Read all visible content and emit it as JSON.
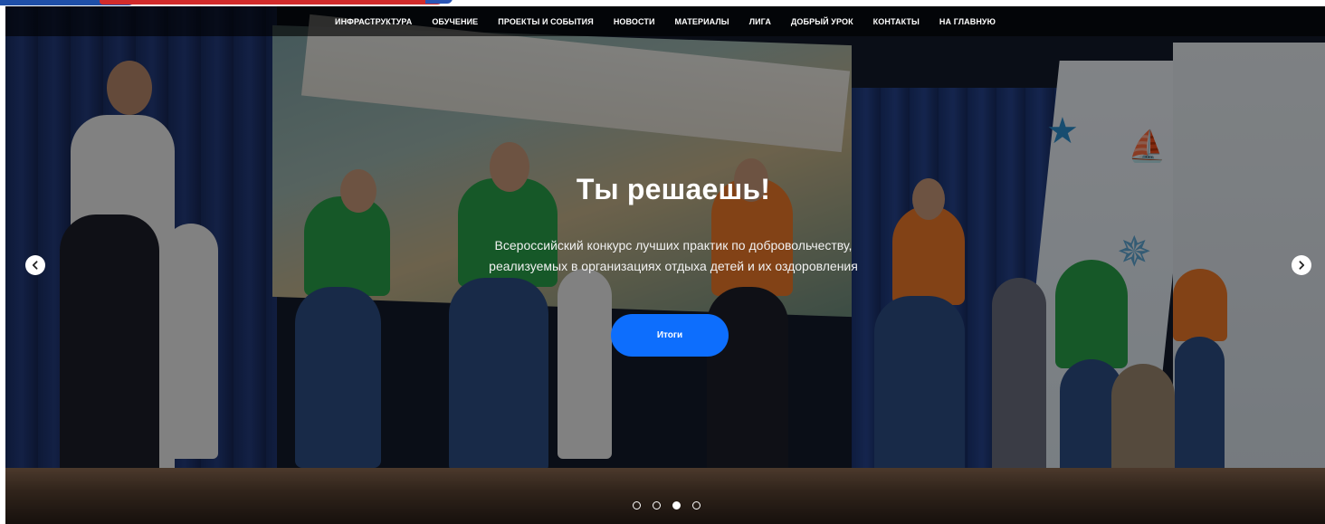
{
  "nav": {
    "items": [
      {
        "label": "ИНФРАСТРУКТУРА"
      },
      {
        "label": "ОБУЧЕНИЕ"
      },
      {
        "label": "ПРОЕКТЫ И СОБЫТИЯ"
      },
      {
        "label": "НОВОСТИ"
      },
      {
        "label": "МАТЕРИАЛЫ"
      },
      {
        "label": "ЛИГА"
      },
      {
        "label": "ДОБРЫЙ УРОК"
      },
      {
        "label": "КОНТАКТЫ"
      },
      {
        "label": "НА ГЛАВНУЮ"
      }
    ]
  },
  "slide": {
    "title": "Ты решаешь!",
    "subtitle_line1": "Всероссийский конкурс лучших практик по добровольчеству,",
    "subtitle_line2": "реализуемых в организациях отдыха детей и их оздоровления",
    "button_label": "Итоги",
    "image_icon": "stage-performance-photo"
  },
  "slider": {
    "prev_icon": "chevron-left-icon",
    "next_icon": "chevron-right-icon",
    "dot_count": 4,
    "active_dot": 3
  },
  "colors": {
    "accent": "#0d6efd",
    "nav_background": "#000000",
    "text": "#ffffff"
  }
}
